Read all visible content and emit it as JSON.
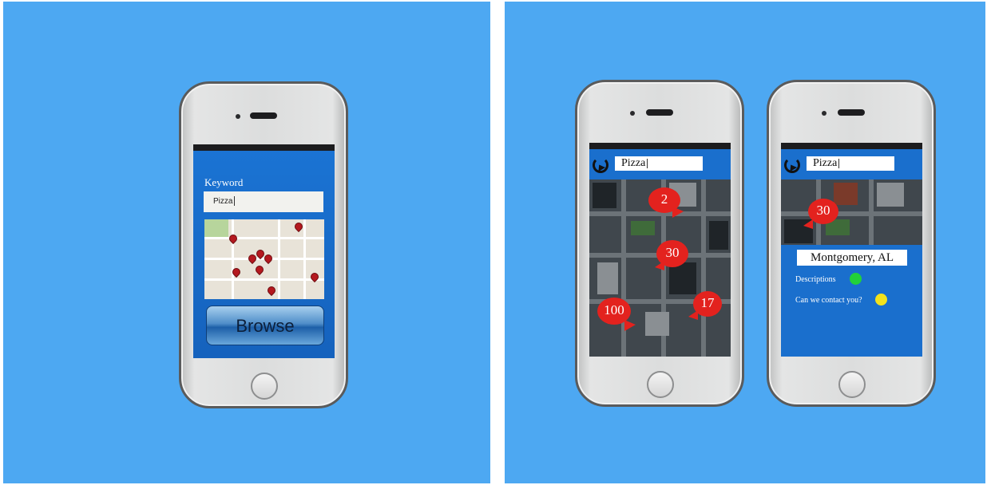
{
  "left_phone": {
    "keyword_label": "Keyword",
    "keyword_value": "Pizza",
    "browse_label": "Browse"
  },
  "middle_phone": {
    "search_value": "Pizza",
    "markers": [
      "2",
      "30",
      "100",
      "17"
    ]
  },
  "right_phone": {
    "search_value": "Pizza",
    "marker": "30",
    "location": "Montgomery, AL",
    "descriptions_label": "Descriptions",
    "contact_label": "Can we contact you?",
    "colors": {
      "descriptions_dot": "#22d13a",
      "contact_dot": "#f2e21c"
    }
  },
  "colors": {
    "background": "#4da8f2",
    "screen_blue": "#1a6fcd",
    "marker_red": "#e3221e",
    "pin_red": "#b4191f"
  },
  "icons": [
    "back-arrow-icon",
    "map-pin-icon",
    "home-button-icon"
  ]
}
